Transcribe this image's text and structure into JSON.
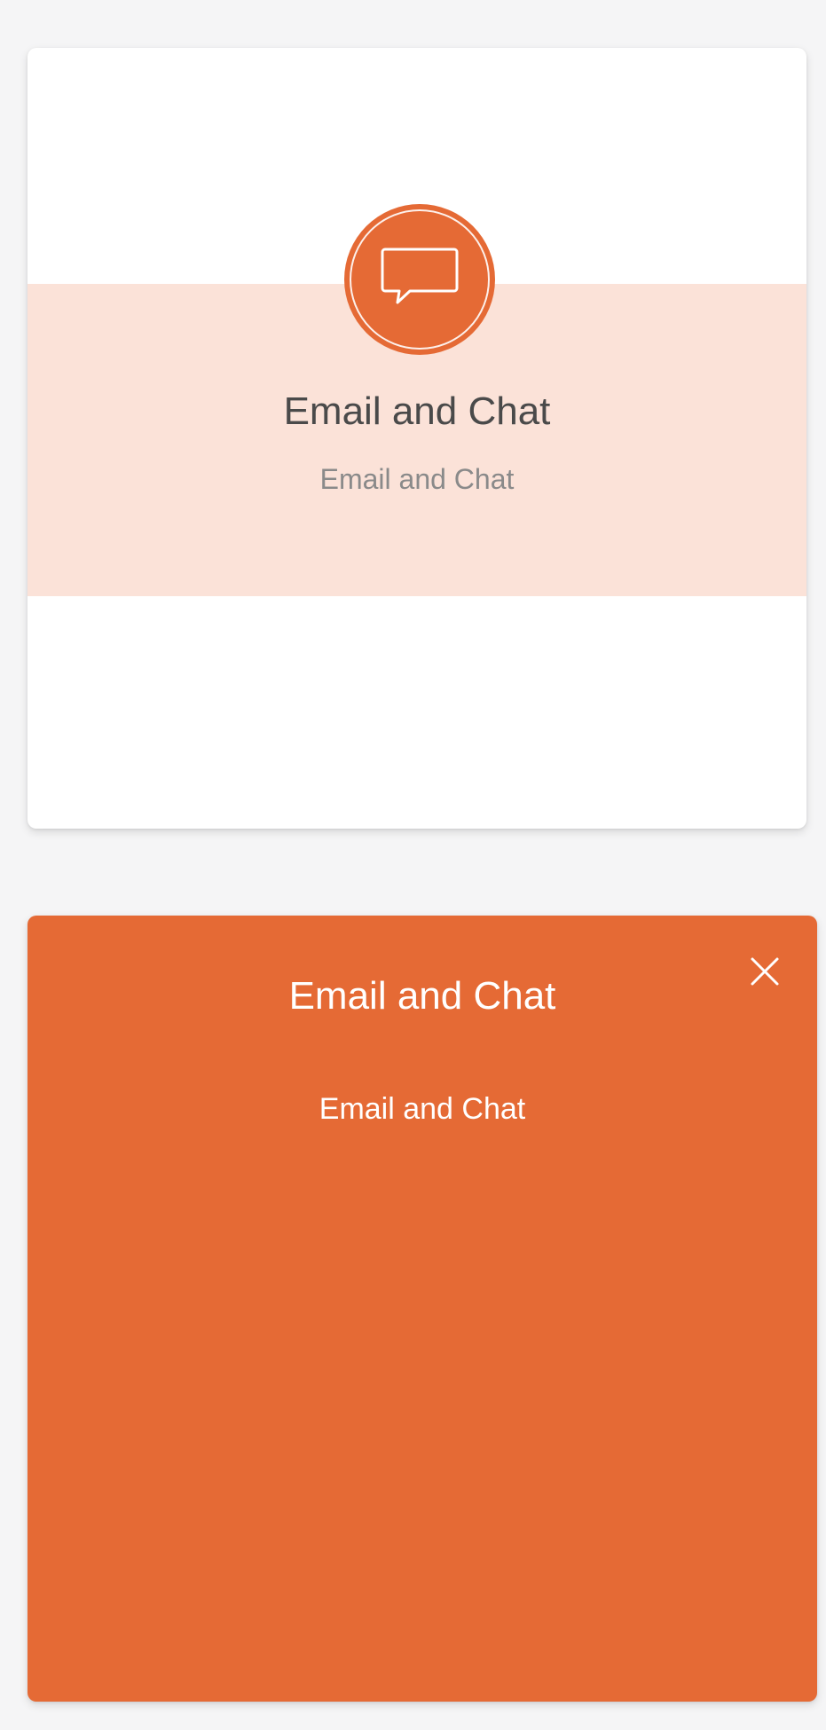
{
  "colors": {
    "page_background": "#f5f5f6",
    "accent": "#e56a35",
    "band": "#fbe2d8",
    "card_background": "#ffffff"
  },
  "top_card": {
    "icon": "chat-bubble-icon",
    "title": "Email and Chat",
    "subtitle": "Email and Chat"
  },
  "bottom_card": {
    "title": "Email and Chat",
    "description": "Email and Chat",
    "close_icon": "close-icon"
  }
}
